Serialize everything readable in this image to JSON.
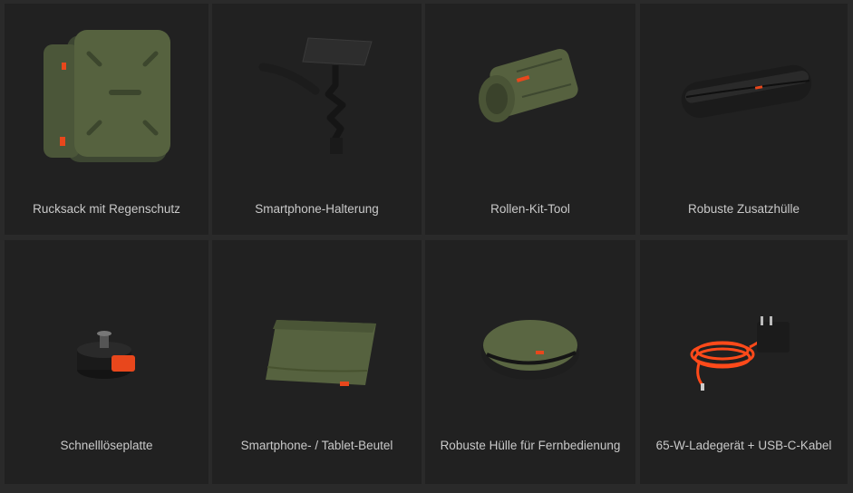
{
  "items": [
    {
      "label": "Rucksack mit Regenschutz",
      "icon": "backpack-icon"
    },
    {
      "label": "Smartphone-Halterung",
      "icon": "phone-holder-icon"
    },
    {
      "label": "Rollen-Kit-Tool",
      "icon": "tool-roll-icon"
    },
    {
      "label": "Robuste Zusatzhülle",
      "icon": "hard-case-icon"
    },
    {
      "label": "Schnelllöseplatte",
      "icon": "quick-release-plate-icon"
    },
    {
      "label": "Smartphone- / Tablet-Beutel",
      "icon": "tablet-pouch-icon"
    },
    {
      "label": "Robuste Hülle für Fernbedienung",
      "icon": "remote-case-icon"
    },
    {
      "label": "65-W-Ladegerät + USB-C-Kabel",
      "icon": "charger-icon"
    }
  ],
  "colors": {
    "page_bg": "#2a2a2a",
    "card_bg": "#212121",
    "label": "#c9c9c9",
    "olive": "#4d5a3b",
    "accent_orange": "#e8471c"
  }
}
